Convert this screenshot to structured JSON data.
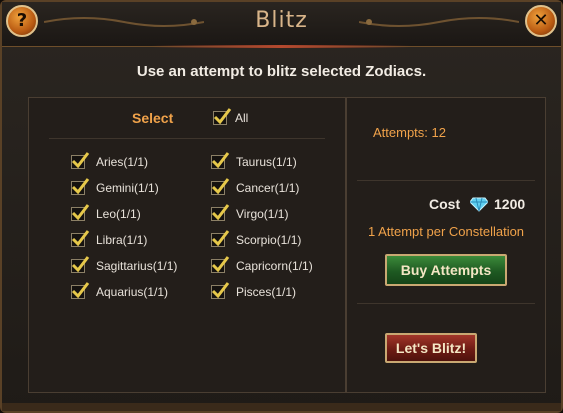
{
  "dialog": {
    "title": "Blitz",
    "help_icon": "question-icon",
    "close_icon": "close-x-icon",
    "subtitle": "Use an attempt to blitz selected Zodiacs."
  },
  "selection": {
    "select_label": "Select",
    "all_label": "All",
    "all_checked": true,
    "zodiacs": [
      {
        "label": "Aries(1/1)",
        "checked": true
      },
      {
        "label": "Taurus(1/1)",
        "checked": true
      },
      {
        "label": "Gemini(1/1)",
        "checked": true
      },
      {
        "label": "Cancer(1/1)",
        "checked": true
      },
      {
        "label": "Leo(1/1)",
        "checked": true
      },
      {
        "label": "Virgo(1/1)",
        "checked": true
      },
      {
        "label": "Libra(1/1)",
        "checked": true
      },
      {
        "label": "Scorpio(1/1)",
        "checked": true
      },
      {
        "label": "Sagittarius(1/1)",
        "checked": true
      },
      {
        "label": "Capricorn(1/1)",
        "checked": true
      },
      {
        "label": "Aquarius(1/1)",
        "checked": true
      },
      {
        "label": "Pisces(1/1)",
        "checked": true
      }
    ]
  },
  "info": {
    "attempts_text": "Attempts: 12",
    "cost_label": "Cost",
    "cost_value": "1200",
    "per_text": "1 Attempt per Constellation",
    "buy_button": "Buy Attempts",
    "blitz_button": "Let's Blitz!"
  },
  "colors": {
    "accent": "#f0a24a",
    "check": "#e6c84a",
    "gem": "#5fd0f0"
  }
}
